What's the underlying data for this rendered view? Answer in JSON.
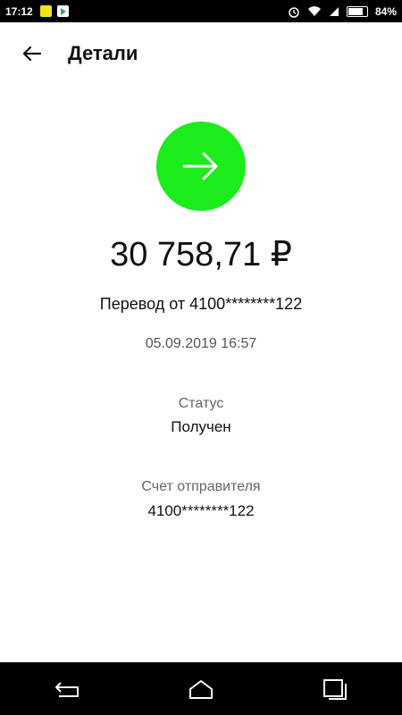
{
  "status_bar": {
    "time": "17:12",
    "battery": "84%",
    "icons": [
      "yellow-notification-icon",
      "play-store-icon",
      "alarm-icon",
      "wifi-icon",
      "signal-icon",
      "battery-icon"
    ]
  },
  "header": {
    "title": "Детали",
    "back_icon": "arrow-left-icon"
  },
  "transaction": {
    "icon": "arrow-right-icon",
    "icon_color": "#1cec1c",
    "amount": "30 758,71 ₽",
    "description": "Перевод от 4100********122",
    "datetime": "05.09.2019 16:57"
  },
  "details": {
    "status_label": "Статус",
    "status_value": "Получен",
    "sender_label": "Счет отправителя",
    "sender_value": "4100********122"
  },
  "nav_bar": {
    "buttons": [
      "back-nav-icon",
      "home-nav-icon",
      "recents-nav-icon"
    ]
  }
}
